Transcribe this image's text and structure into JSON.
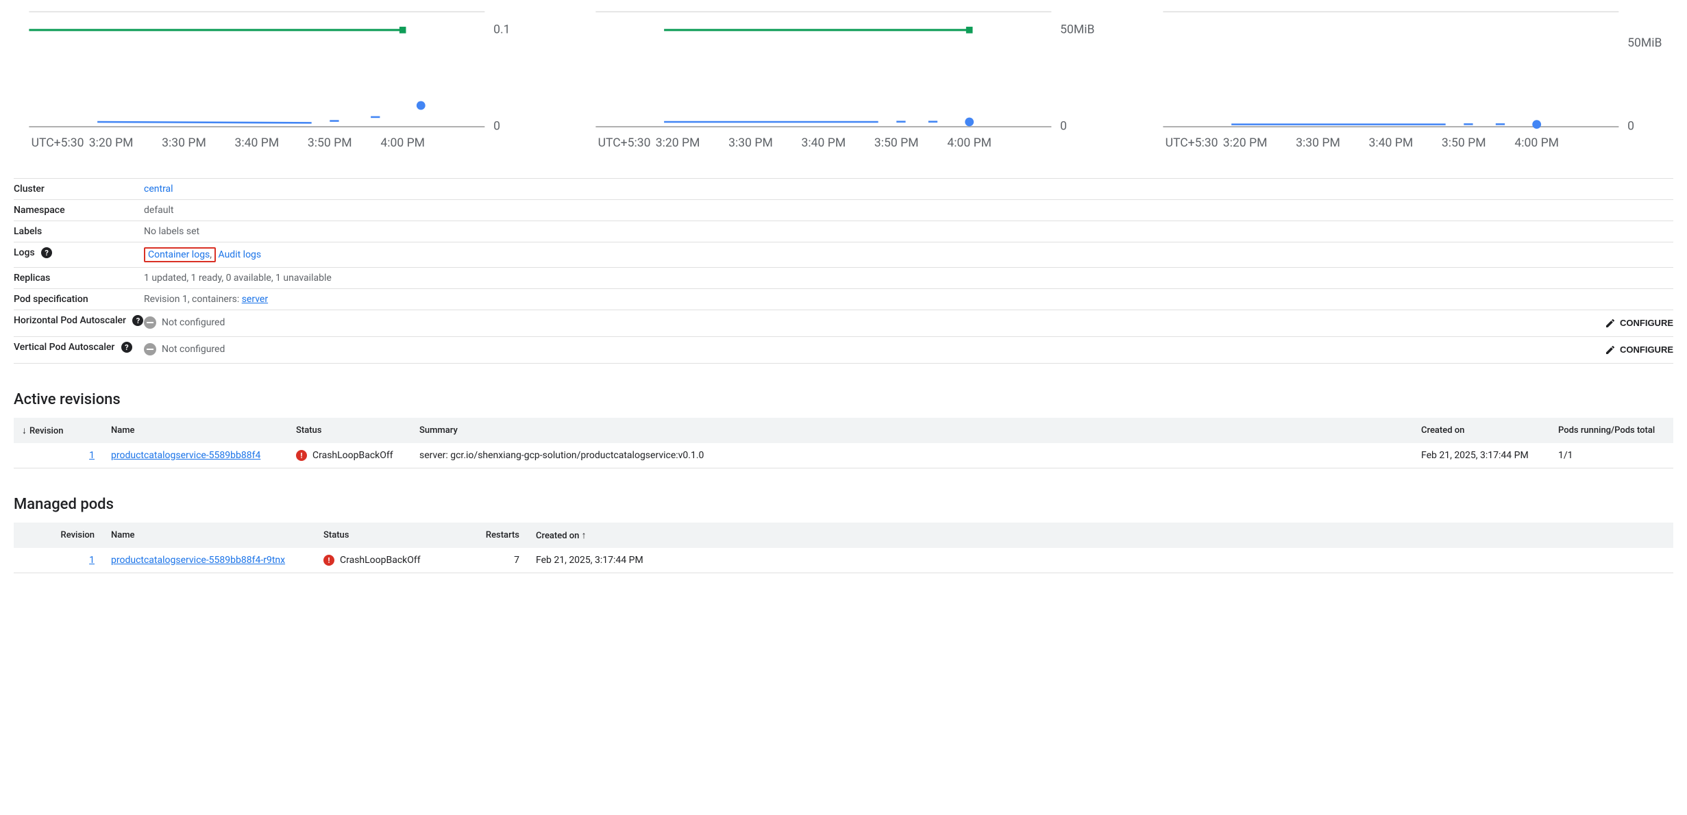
{
  "chart_data": [
    {
      "type": "line",
      "tz_label": "UTC+5:30",
      "x_ticks": [
        "3:20 PM",
        "3:30 PM",
        "3:40 PM",
        "3:50 PM",
        "4:00 PM"
      ],
      "side_labels_top": "0.1",
      "side_labels_bottom": "0",
      "series": [
        {
          "name": "green",
          "y": 0.1,
          "xrange": [
            0,
            0.82
          ]
        },
        {
          "name": "blue-segments",
          "segments": [
            {
              "x": [
                0.15,
                0.62
              ],
              "y": [
                0.005,
                0.004
              ]
            },
            {
              "x": [
                0.66,
                0.68
              ],
              "y": [
                0.006,
                0.006
              ]
            },
            {
              "x": [
                0.75,
                0.77
              ],
              "y": [
                0.01,
                0.01
              ]
            }
          ],
          "end_dot": {
            "x": 0.86,
            "y": 0.022
          }
        }
      ],
      "ylim": [
        0,
        0.12
      ]
    },
    {
      "type": "line",
      "tz_label": "UTC+5:30",
      "x_ticks": [
        "3:20 PM",
        "3:30 PM",
        "3:40 PM",
        "3:50 PM",
        "4:00 PM"
      ],
      "side_labels_top": "50MiB",
      "side_labels_bottom": "0",
      "series": [
        {
          "name": "green",
          "y": 50,
          "xrange": [
            0.15,
            0.82
          ]
        },
        {
          "name": "blue-segments",
          "segments": [
            {
              "x": [
                0.15,
                0.62
              ],
              "y": [
                2.5,
                2.5
              ]
            },
            {
              "x": [
                0.66,
                0.68
              ],
              "y": [
                2.6,
                2.6
              ]
            },
            {
              "x": [
                0.73,
                0.75
              ],
              "y": [
                2.6,
                2.6
              ]
            }
          ],
          "end_dot": {
            "x": 0.82,
            "y": 2.5
          }
        }
      ],
      "ylim": [
        0,
        60
      ]
    },
    {
      "type": "line",
      "tz_label": "UTC+5:30",
      "x_ticks": [
        "3:20 PM",
        "3:30 PM",
        "3:40 PM",
        "3:50 PM",
        "4:00 PM"
      ],
      "side_labels_top": "50MiB",
      "side_labels_bottom": "0",
      "series": [
        {
          "name": "blue-segments",
          "segments": [
            {
              "x": [
                0.15,
                0.62
              ],
              "y": [
                1.2,
                1.2
              ]
            },
            {
              "x": [
                0.66,
                0.68
              ],
              "y": [
                1.3,
                1.3
              ]
            },
            {
              "x": [
                0.73,
                0.75
              ],
              "y": [
                1.3,
                1.3
              ]
            }
          ],
          "end_dot": {
            "x": 0.82,
            "y": 1.2
          }
        }
      ],
      "ylim": [
        0,
        60
      ]
    }
  ],
  "details": {
    "cluster": {
      "label": "Cluster",
      "value": "central"
    },
    "namespace": {
      "label": "Namespace",
      "value": "default"
    },
    "labels": {
      "label": "Labels",
      "value": "No labels set"
    },
    "logs": {
      "label": "Logs",
      "container_logs": "Container logs",
      "audit_logs": "Audit logs"
    },
    "replicas": {
      "label": "Replicas",
      "value": "1 updated, 1 ready, 0 available, 1 unavailable"
    },
    "podspec": {
      "label": "Pod specification",
      "prefix": "Revision 1, containers: ",
      "server": "server"
    },
    "hpa": {
      "label": "Horizontal Pod Autoscaler",
      "value": "Not configured",
      "button": "CONFIGURE"
    },
    "vpa": {
      "label": "Vertical Pod Autoscaler",
      "value": "Not configured",
      "button": "CONFIGURE"
    }
  },
  "active_revisions": {
    "heading": "Active revisions",
    "columns": {
      "revision": "Revision",
      "name": "Name",
      "status": "Status",
      "summary": "Summary",
      "created": "Created on",
      "pods": "Pods running/Pods total"
    },
    "rows": [
      {
        "revision": "1",
        "name": "productcatalogservice-5589bb88f4",
        "status": "CrashLoopBackOff",
        "summary": "server: gcr.io/shenxiang-gcp-solution/productcatalogservice:v0.1.0",
        "created": "Feb 21, 2025, 3:17:44 PM",
        "pods": "1/1"
      }
    ]
  },
  "managed_pods": {
    "heading": "Managed pods",
    "columns": {
      "revision": "Revision",
      "name": "Name",
      "status": "Status",
      "restarts": "Restarts",
      "created": "Created on"
    },
    "rows": [
      {
        "revision": "1",
        "name": "productcatalogservice-5589bb88f4-r9tnx",
        "status": "CrashLoopBackOff",
        "restarts": "7",
        "created": "Feb 21, 2025, 3:17:44 PM"
      }
    ]
  }
}
